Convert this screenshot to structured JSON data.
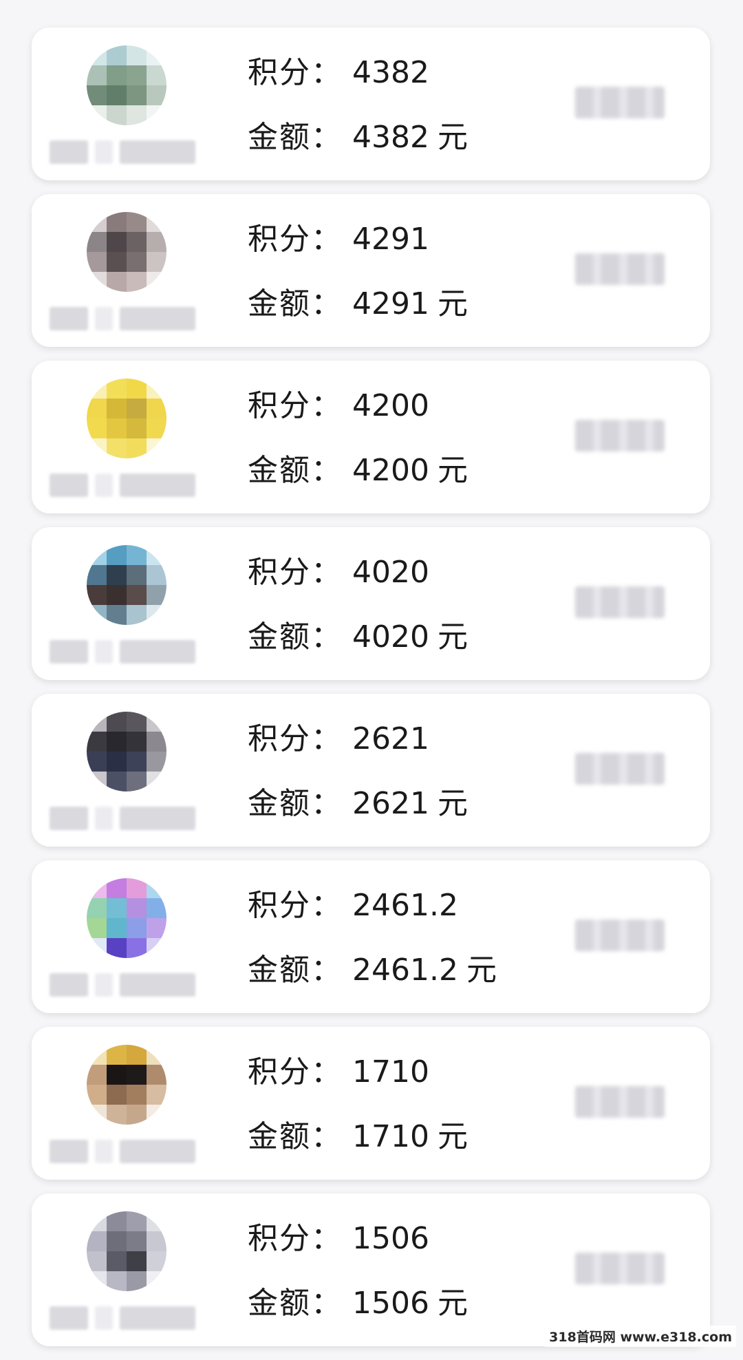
{
  "labels": {
    "points_label": "积分：",
    "amount_label": "金额：",
    "unit": "元"
  },
  "entries": [
    {
      "points": "4382",
      "amount": "4382",
      "avatar_colors": [
        "#cfe6e8",
        "#a9cdd3",
        "#d2e5e6",
        "#e8f2f2",
        "#a9c2b4",
        "#7e9f86",
        "#88a58f",
        "#c8d8d0",
        "#6f8d77",
        "#5e7f67",
        "#7b977f",
        "#b8c8bc",
        "#e9efeb",
        "#c9d6cd",
        "#dde6df",
        "#f2f5f3"
      ]
    },
    {
      "points": "4291",
      "amount": "4291",
      "avatar_colors": [
        "#d6cdcf",
        "#8a7a7c",
        "#9a8a8a",
        "#e0dada",
        "#8d8588",
        "#4f4648",
        "#6c6264",
        "#b7adad",
        "#a7999b",
        "#5b5051",
        "#7b6f70",
        "#cdc3c3",
        "#e4dcdc",
        "#b9a9a8",
        "#c9bbba",
        "#efe9e9"
      ]
    },
    {
      "points": "4200",
      "amount": "4200",
      "avatar_colors": [
        "#fbf0b0",
        "#f6df4a",
        "#f4d93a",
        "#fbf2b8",
        "#f3d83c",
        "#d9b82a",
        "#c9ab34",
        "#f2d63e",
        "#f5db3f",
        "#e7c733",
        "#d8b92f",
        "#f4da40",
        "#fdf3c0",
        "#f6e05c",
        "#f5dc4e",
        "#fdf6d0"
      ]
    },
    {
      "points": "4020",
      "amount": "4020",
      "avatar_colors": [
        "#9fd3ea",
        "#4e9fc7",
        "#6fb6d8",
        "#c7e6f2",
        "#4e7893",
        "#2f3f4f",
        "#5a6e7c",
        "#a9c6d6",
        "#4a3c3b",
        "#3b302f",
        "#5a4c4a",
        "#8fa1ad",
        "#8fb6c8",
        "#5f7f91",
        "#a8c5d1",
        "#dbe8ee"
      ]
    },
    {
      "points": "2621",
      "amount": "2621",
      "avatar_colors": [
        "#b8b6bb",
        "#4d4a52",
        "#5a565e",
        "#c8c6cb",
        "#3c3a42",
        "#2a2830",
        "#35333b",
        "#8b8990",
        "#3a3f58",
        "#2a2f48",
        "#3d425a",
        "#9a98a0",
        "#c9c7cc",
        "#4c5066",
        "#6d6f80",
        "#e0dfe2"
      ]
    },
    {
      "points": "2461.2",
      "amount": "2461.2",
      "avatar_colors": [
        "#f0b8f0",
        "#c97be8",
        "#e99be0",
        "#a8d8f0",
        "#8fd4b0",
        "#6cc0d8",
        "#b88ee8",
        "#7fb0f0",
        "#a0d890",
        "#58b8d0",
        "#8a9ef0",
        "#c0a0f0",
        "#e0e8f8",
        "#5a3fd0",
        "#8a6ff0",
        "#d8d0f8"
      ]
    },
    {
      "points": "1710",
      "amount": "1710",
      "avatar_colors": [
        "#f4e3b0",
        "#e0b53a",
        "#d9a830",
        "#f1e0b8",
        "#c69c78",
        "#1a1616",
        "#1e1a1a",
        "#b28a6a",
        "#d3ad86",
        "#8f6a4c",
        "#a67d5a",
        "#d9bc9c",
        "#f1e5d6",
        "#d2b394",
        "#c8a888",
        "#f5ece2"
      ]
    },
    {
      "points": "1506",
      "amount": "1506",
      "avatar_colors": [
        "#d9d9e2",
        "#8b8b9a",
        "#9e9ead",
        "#dfdfe7",
        "#b3b3c2",
        "#6e6e7c",
        "#7c7c8a",
        "#c8c8d3",
        "#c1c1cd",
        "#5b5b68",
        "#3f3f49",
        "#d0d0da",
        "#e6e6ed",
        "#b8b8c5",
        "#9a9aa8",
        "#f0f0f4"
      ]
    }
  ],
  "watermark": "318首码网 www.e318.com"
}
